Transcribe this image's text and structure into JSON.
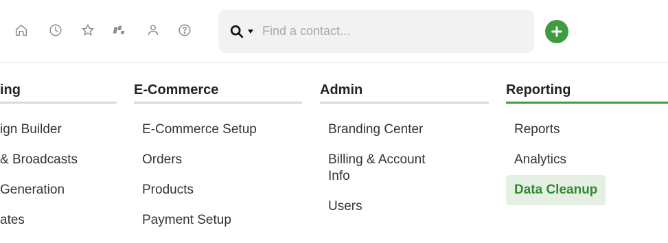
{
  "toolbar": {
    "icons": [
      "home-icon",
      "clock-icon",
      "star-icon",
      "pipeline-icon",
      "person-icon",
      "help-icon"
    ],
    "search_placeholder": "Find a contact...",
    "accent_color": "#3f9b3f"
  },
  "menu": {
    "columns": [
      {
        "title": "ing",
        "items": [
          "ign Builder",
          "& Broadcasts",
          "Generation",
          "ates"
        ]
      },
      {
        "title": "E-Commerce",
        "items": [
          "E-Commerce Setup",
          "Orders",
          "Products",
          "Payment Setup"
        ]
      },
      {
        "title": "Admin",
        "items": [
          "Branding Center",
          "Billing & Account Info",
          "Users"
        ]
      },
      {
        "title": "Reporting",
        "items": [
          "Reports",
          "Analytics",
          "Data Cleanup"
        ]
      }
    ]
  }
}
